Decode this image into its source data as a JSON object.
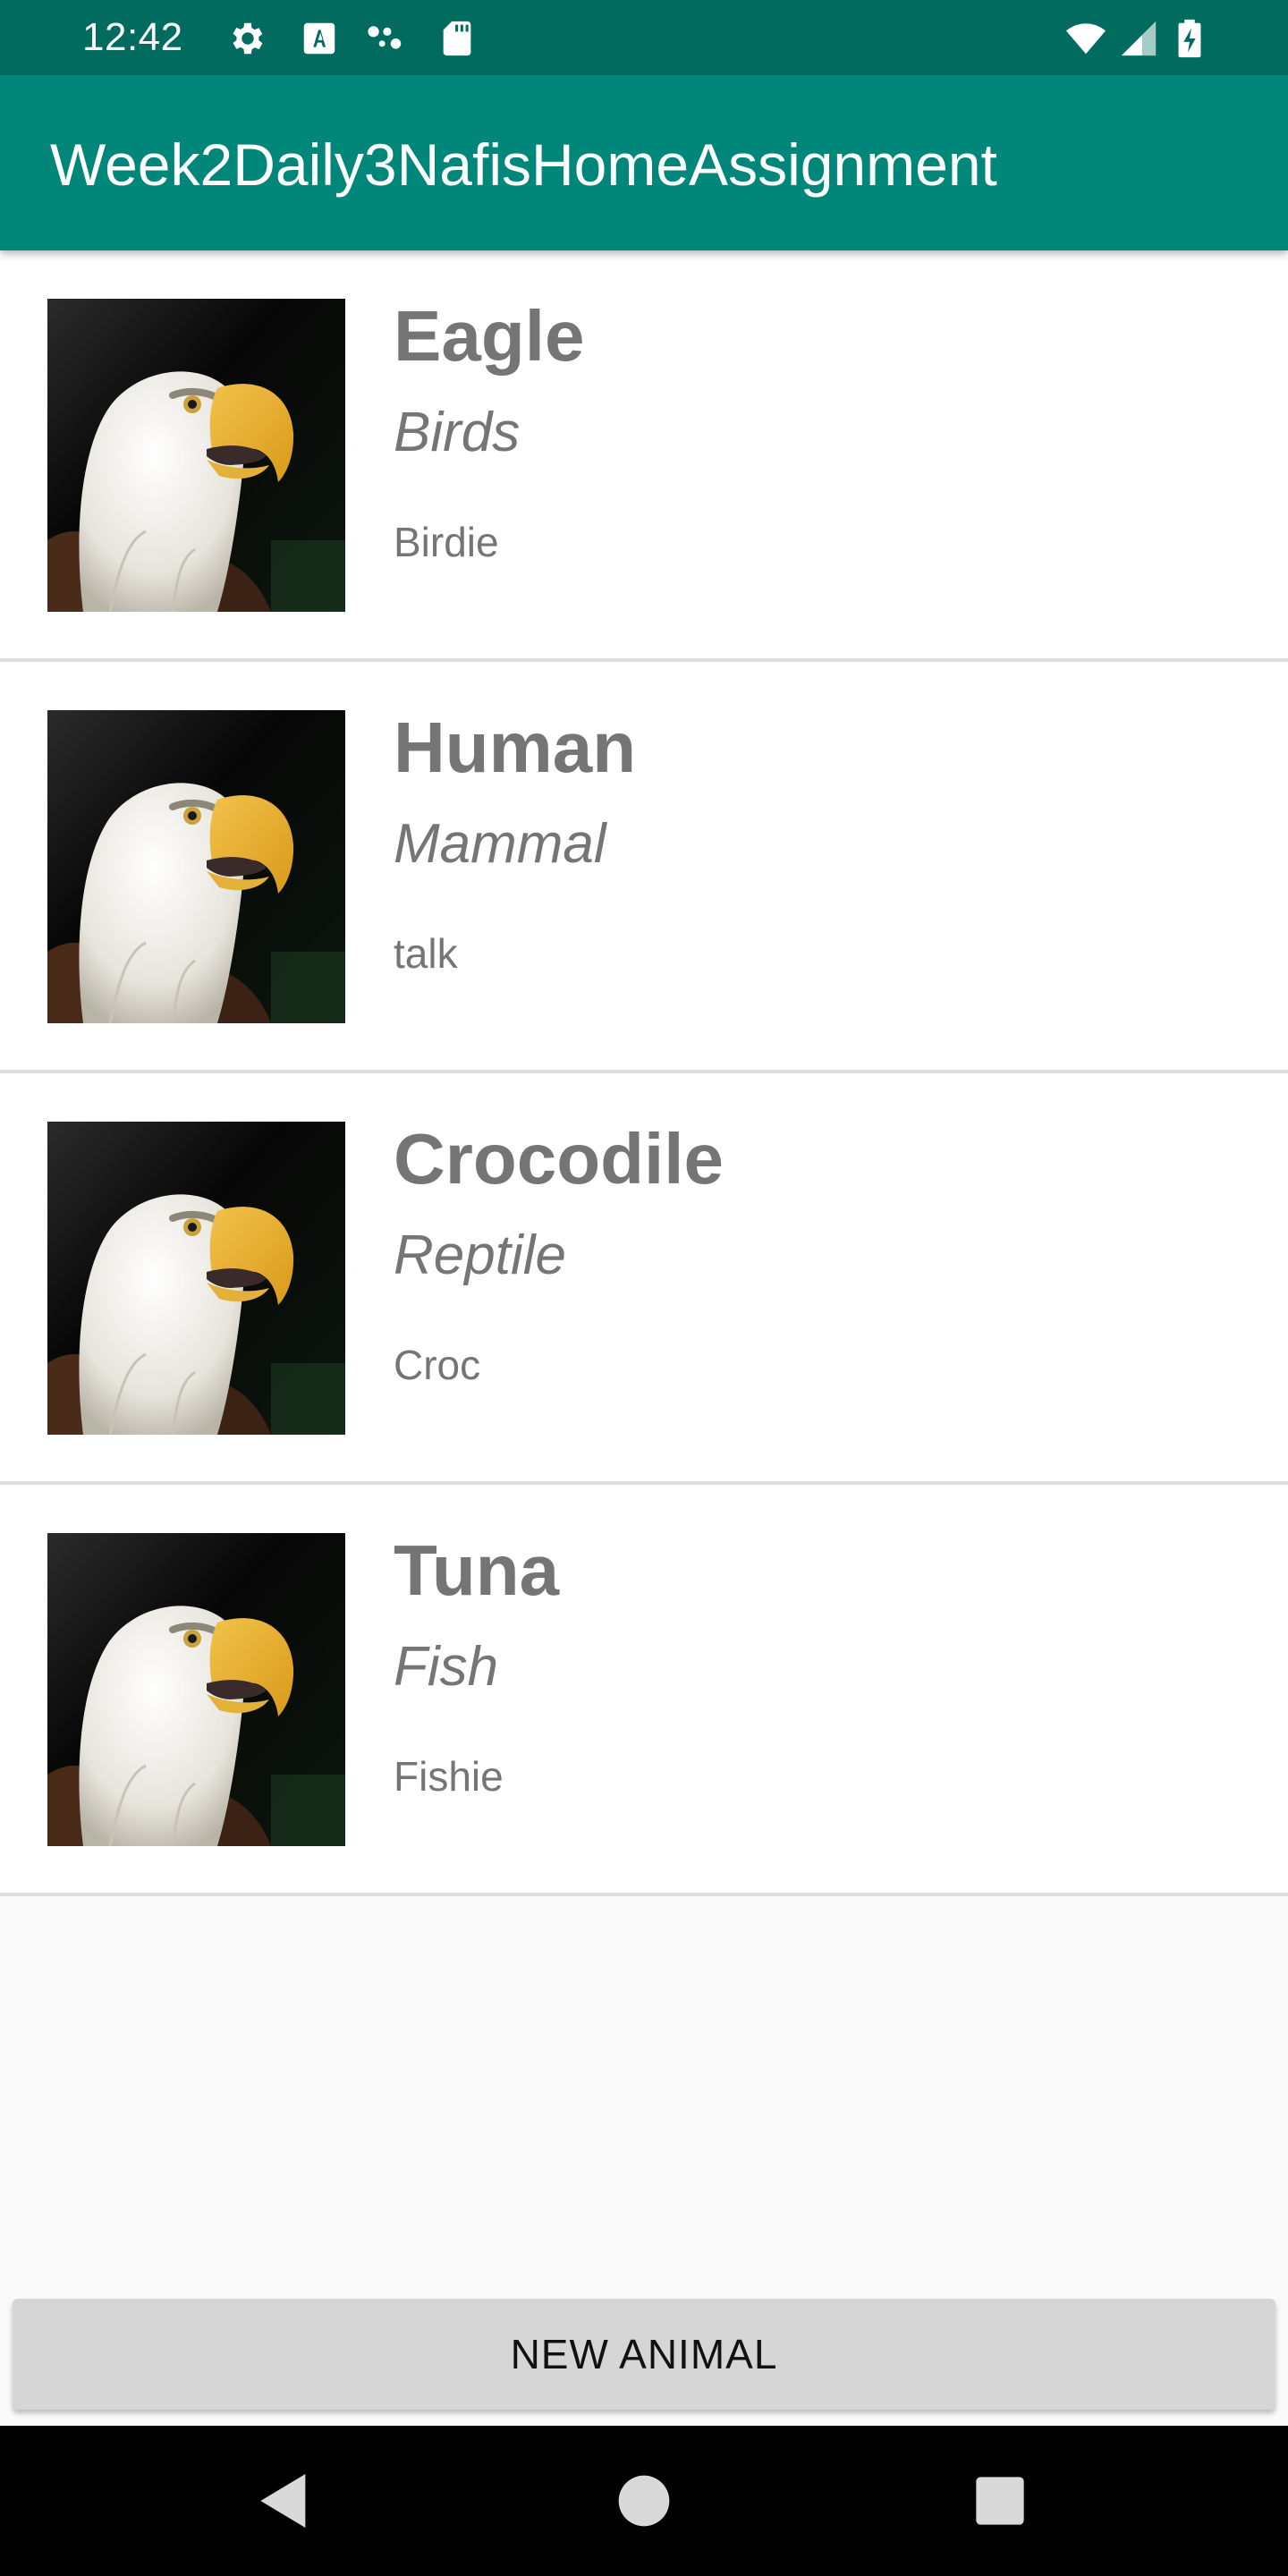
{
  "status_bar": {
    "time": "12:42",
    "left_icons": [
      "gear-icon",
      "text-a-icon",
      "dots-icon",
      "sd-card-icon"
    ],
    "right_icons": [
      "wifi-icon",
      "signal-icon",
      "battery-charging-icon"
    ],
    "bg_color": "#016b5f"
  },
  "app_bar": {
    "title": "Week2Daily3NafisHomeAssignment",
    "bg_color": "#00877a"
  },
  "animals": [
    {
      "name": "Eagle",
      "category": "Birds",
      "sound": "Birdie",
      "image": "eagle-photo"
    },
    {
      "name": "Human",
      "category": "Mammal",
      "sound": "talk",
      "image": "eagle-photo"
    },
    {
      "name": "Crocodile",
      "category": "Reptile",
      "sound": "Croc",
      "image": "eagle-photo"
    },
    {
      "name": "Tuna",
      "category": "Fish",
      "sound": "Fishie",
      "image": "eagle-photo"
    }
  ],
  "new_animal_button": {
    "label": "NEW ANIMAL"
  },
  "nav_bar": {
    "buttons": [
      "back-icon",
      "home-icon",
      "recents-icon"
    ]
  }
}
